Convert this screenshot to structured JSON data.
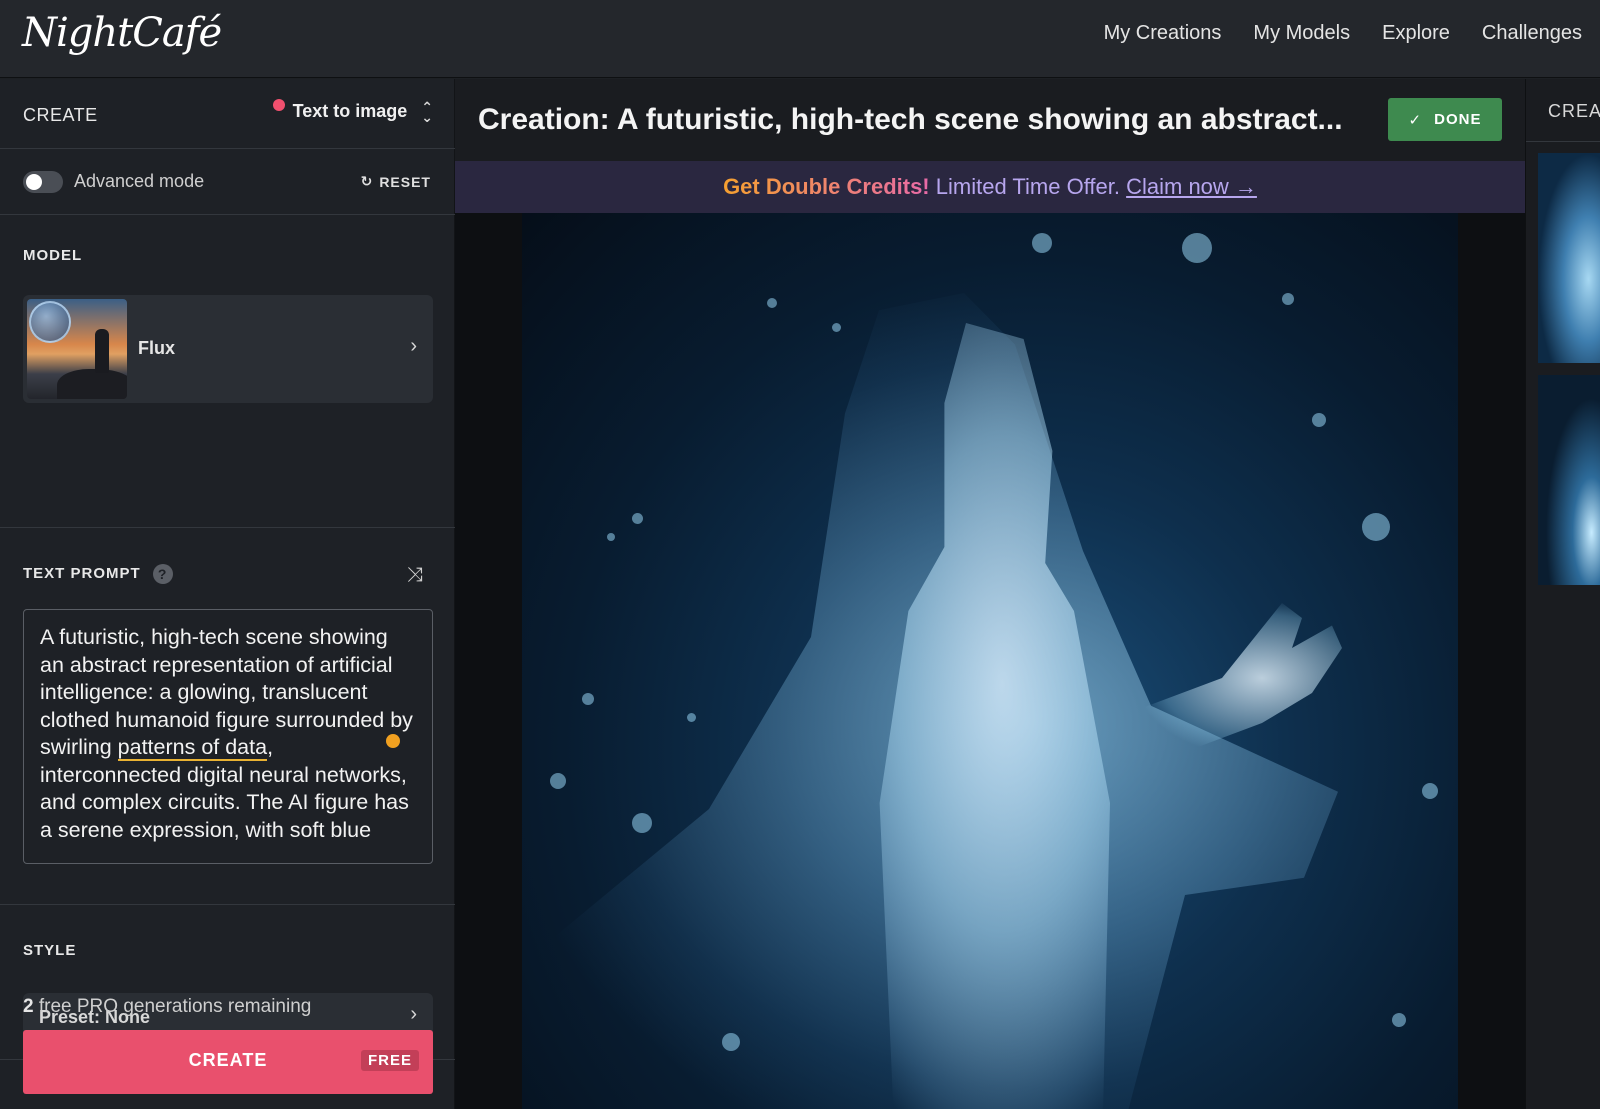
{
  "app": {
    "logo": "NightCafé",
    "nav": [
      "My Creations",
      "My Models",
      "Explore",
      "Challenges"
    ]
  },
  "sidebar": {
    "create_label": "CREATE",
    "mode": "Text to image",
    "advanced_mode_label": "Advanced mode",
    "advanced_mode_on": false,
    "reset_label": "RESET",
    "model_label": "MODEL",
    "model_name": "Flux",
    "text_prompt_label": "TEXT PROMPT",
    "prompt_part1": "A futuristic, high-tech scene showing an abstract representation of artificial intelligence: a glowing, translucent clothed humanoid figure surrounded by swirling ",
    "prompt_highlight": "patterns of data",
    "prompt_part2": ", interconnected digital neural networks, and complex circuits. The AI figure has a serene expression, with soft blue",
    "style_label": "STYLE",
    "style_preset": "Preset: None",
    "remaining_count": "2",
    "remaining_text": "free PRO generations remaining",
    "create_button": "CREATE",
    "free_badge": "FREE"
  },
  "main": {
    "title": "Creation: A futuristic, high-tech scene showing an abstract...",
    "done_button": "DONE",
    "banner_highlight": "Get Double Credits!",
    "banner_text": "Limited Time Offer.",
    "banner_link": "Claim now →"
  },
  "right": {
    "title": "CREAT"
  },
  "colors": {
    "accent": "#e9506d",
    "done": "#3e8a4f",
    "banner_bg": "#2a2740"
  }
}
